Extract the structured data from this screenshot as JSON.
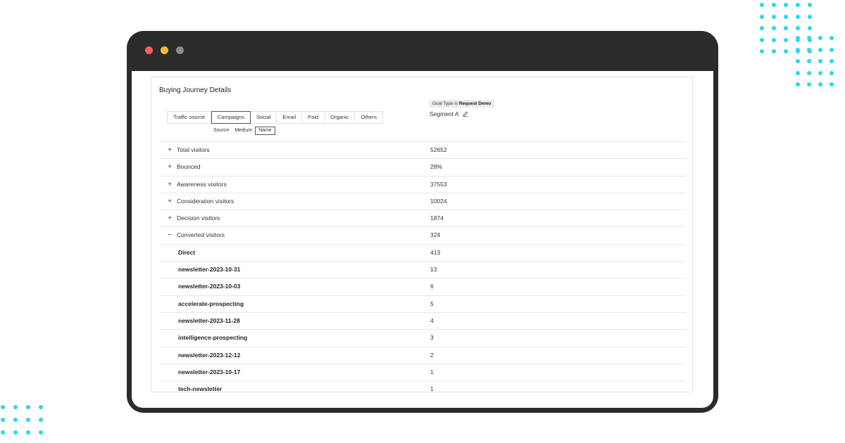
{
  "window": {
    "title_dots": [
      "close",
      "minimize",
      "zoom"
    ]
  },
  "panel": {
    "title": "Buying Journey Details"
  },
  "tabs": [
    {
      "label": "Traffic source",
      "active": false
    },
    {
      "label": "Campaigns",
      "active": true
    },
    {
      "label": "Social",
      "active": false
    },
    {
      "label": "Email",
      "active": false
    },
    {
      "label": "Paid",
      "active": false
    },
    {
      "label": "Organic",
      "active": false
    },
    {
      "label": "Others",
      "active": false
    }
  ],
  "subtabs": [
    {
      "label": "Source",
      "active": false
    },
    {
      "label": "Medium",
      "active": false
    },
    {
      "label": "Name",
      "active": true
    }
  ],
  "goal": {
    "prefix": "Goal Type is",
    "value": "Request Demo"
  },
  "segment": {
    "label": "Segment A",
    "icon": "pencil-icon"
  },
  "rows": [
    {
      "expander": "+",
      "label": "Total visitors",
      "value": "52652",
      "child": false
    },
    {
      "expander": "+",
      "label": "Bounced",
      "value": "28%",
      "child": false
    },
    {
      "expander": "+",
      "label": "Awareness visitors",
      "value": "37553",
      "child": false
    },
    {
      "expander": "+",
      "label": "Consideration visitors",
      "value": "10024",
      "child": false
    },
    {
      "expander": "+",
      "label": "Decision visitors",
      "value": "1874",
      "child": false
    },
    {
      "expander": "−",
      "label": "Converted visitors",
      "value": "324",
      "child": false
    },
    {
      "expander": "",
      "label": "Direct",
      "value": "413",
      "child": true
    },
    {
      "expander": "",
      "label": "newsletter-2023-10-31",
      "value": "13",
      "child": true
    },
    {
      "expander": "",
      "label": "newsletter-2023-10-03",
      "value": "6",
      "child": true
    },
    {
      "expander": "",
      "label": "accelerate-prospecting",
      "value": "5",
      "child": true
    },
    {
      "expander": "",
      "label": "newsletter-2023-11-28",
      "value": "4",
      "child": true
    },
    {
      "expander": "",
      "label": "intelligence-prospecting",
      "value": "3",
      "child": true
    },
    {
      "expander": "",
      "label": "newsletter-2023-12-12",
      "value": "2",
      "child": true
    },
    {
      "expander": "",
      "label": "newsletter-2023-10-17",
      "value": "1",
      "child": true
    },
    {
      "expander": "",
      "label": "tech-newsletter",
      "value": "1",
      "child": true
    }
  ],
  "colors": {
    "accent_dots": "#2ad9e6",
    "frame": "#2b2b2b"
  }
}
